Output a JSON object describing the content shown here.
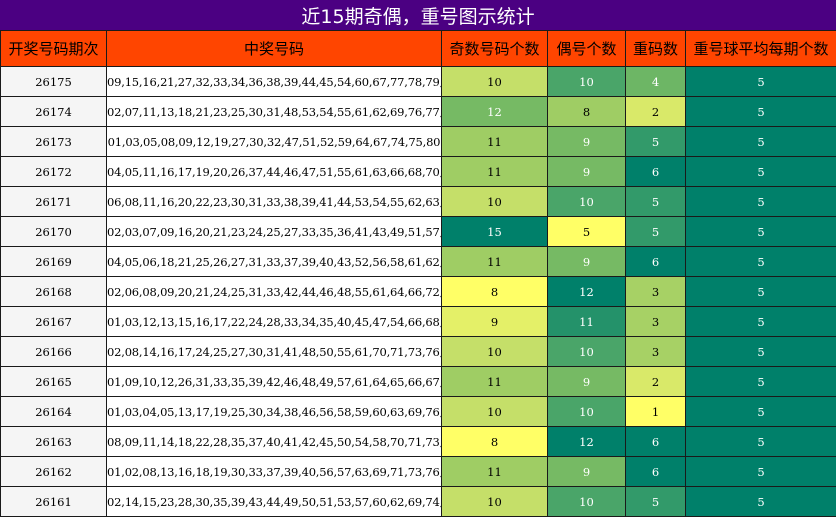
{
  "title": "近15期奇偶，重号图示统计",
  "headers": [
    "开奖号码期次",
    "中奖号码",
    "奇数号码个数",
    "偶号个数",
    "重码数",
    "重号球平均每期个数"
  ],
  "chart_data": {
    "type": "table",
    "columns": [
      "开奖号码期次",
      "中奖号码",
      "奇数号码个数",
      "偶号个数",
      "重码数",
      "重号球平均每期个数"
    ],
    "rows": [
      {
        "period": "26175",
        "numbers": "09,15,16,21,27,32,33,34,36,38,39,44,45,54,60,67,77,78,79,80",
        "odd": 10,
        "even": 10,
        "repeat": 4,
        "avg": 5
      },
      {
        "period": "26174",
        "numbers": "02,07,11,13,18,21,23,25,30,31,48,53,54,55,61,62,69,76,77,80",
        "odd": 12,
        "even": 8,
        "repeat": 2,
        "avg": 5
      },
      {
        "period": "26173",
        "numbers": "01,03,05,08,09,12,19,27,30,32,47,51,52,59,64,67,74,75,80",
        "odd": 11,
        "even": 9,
        "repeat": 5,
        "avg": 5
      },
      {
        "period": "26172",
        "numbers": "04,05,11,16,17,19,20,26,37,44,46,47,51,55,61,63,66,68,70,75",
        "odd": 11,
        "even": 9,
        "repeat": 6,
        "avg": 5
      },
      {
        "period": "26171",
        "numbers": "06,08,11,16,20,22,23,30,31,33,38,39,41,44,53,54,55,62,63,79",
        "odd": 10,
        "even": 10,
        "repeat": 5,
        "avg": 5
      },
      {
        "period": "26170",
        "numbers": "02,03,07,09,16,20,21,23,24,25,27,33,35,36,41,43,49,51,57,65",
        "odd": 15,
        "even": 5,
        "repeat": 5,
        "avg": 5
      },
      {
        "period": "26169",
        "numbers": "04,05,06,18,21,25,26,27,31,33,37,39,40,43,52,56,58,61,62,73",
        "odd": 11,
        "even": 9,
        "repeat": 6,
        "avg": 5
      },
      {
        "period": "26168",
        "numbers": "02,06,08,09,20,21,24,25,31,33,42,44,46,48,55,61,64,66,72,77",
        "odd": 8,
        "even": 12,
        "repeat": 3,
        "avg": 5
      },
      {
        "period": "26167",
        "numbers": "01,03,12,13,15,16,17,22,24,28,33,34,35,40,45,47,54,66,68,74",
        "odd": 9,
        "even": 11,
        "repeat": 3,
        "avg": 5
      },
      {
        "period": "26166",
        "numbers": "02,08,14,16,17,24,25,27,30,31,41,48,50,55,61,70,71,73,76,79",
        "odd": 10,
        "even": 10,
        "repeat": 3,
        "avg": 5
      },
      {
        "period": "26165",
        "numbers": "01,09,10,12,26,31,33,35,39,42,46,48,49,57,61,64,65,66,67,74",
        "odd": 11,
        "even": 9,
        "repeat": 2,
        "avg": 5
      },
      {
        "period": "26164",
        "numbers": "01,03,04,05,13,17,19,25,30,34,38,46,56,58,59,60,63,69,76,80",
        "odd": 10,
        "even": 10,
        "repeat": 1,
        "avg": 5
      },
      {
        "period": "26163",
        "numbers": "08,09,11,14,18,22,28,35,37,40,41,42,45,50,54,58,70,71,73,74",
        "odd": 8,
        "even": 12,
        "repeat": 6,
        "avg": 5
      },
      {
        "period": "26162",
        "numbers": "01,02,08,13,16,18,19,30,33,37,39,40,56,57,63,69,71,73,76,78",
        "odd": 11,
        "even": 9,
        "repeat": 6,
        "avg": 5
      },
      {
        "period": "26161",
        "numbers": "02,14,15,23,28,30,35,39,43,44,49,50,51,53,57,60,62,69,74,76",
        "odd": 10,
        "even": 10,
        "repeat": 5,
        "avg": 5
      }
    ]
  }
}
